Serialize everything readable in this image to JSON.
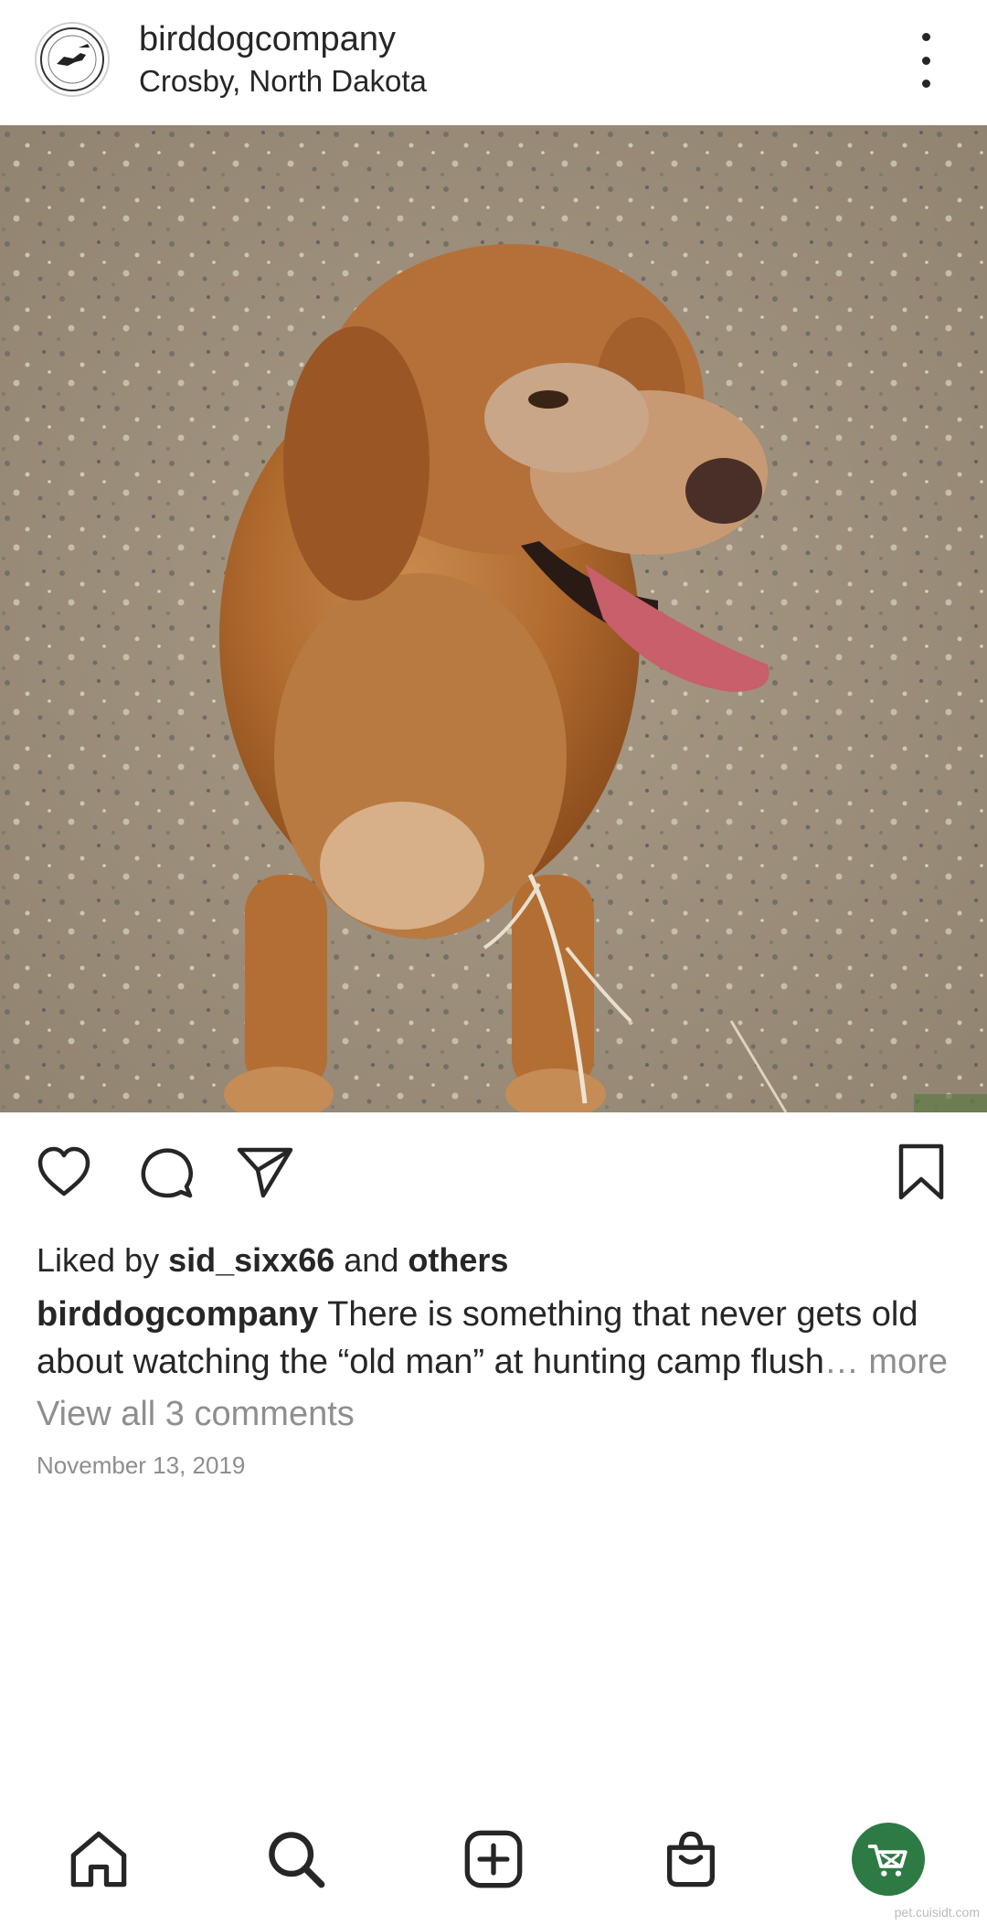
{
  "post": {
    "username": "birddogcompany",
    "location": "Crosby, North Dakota",
    "liked_prefix": "Liked by",
    "liked_user": "sid_sixx66",
    "liked_mid": "and",
    "liked_others": "others",
    "caption_user": "birddogcompany",
    "caption_text": "There is something that never gets old about watching the “old man” at hunting camp flush",
    "caption_more": "… more",
    "view_comments": "View all 3 comments",
    "date": "November 13, 2019"
  },
  "icons": {
    "more": "more-vertical-icon",
    "like": "heart-icon",
    "comment": "comment-icon",
    "share": "send-icon",
    "save": "bookmark-icon",
    "home": "home-icon",
    "search": "search-icon",
    "create": "plus-square-icon",
    "shop": "shopping-bag-icon",
    "cart": "shopping-cart-icon"
  },
  "colors": {
    "text": "#262626",
    "muted": "#8e8e8e",
    "cart_bg": "#2d7a44"
  },
  "watermark": "pet.cuisidt.com"
}
